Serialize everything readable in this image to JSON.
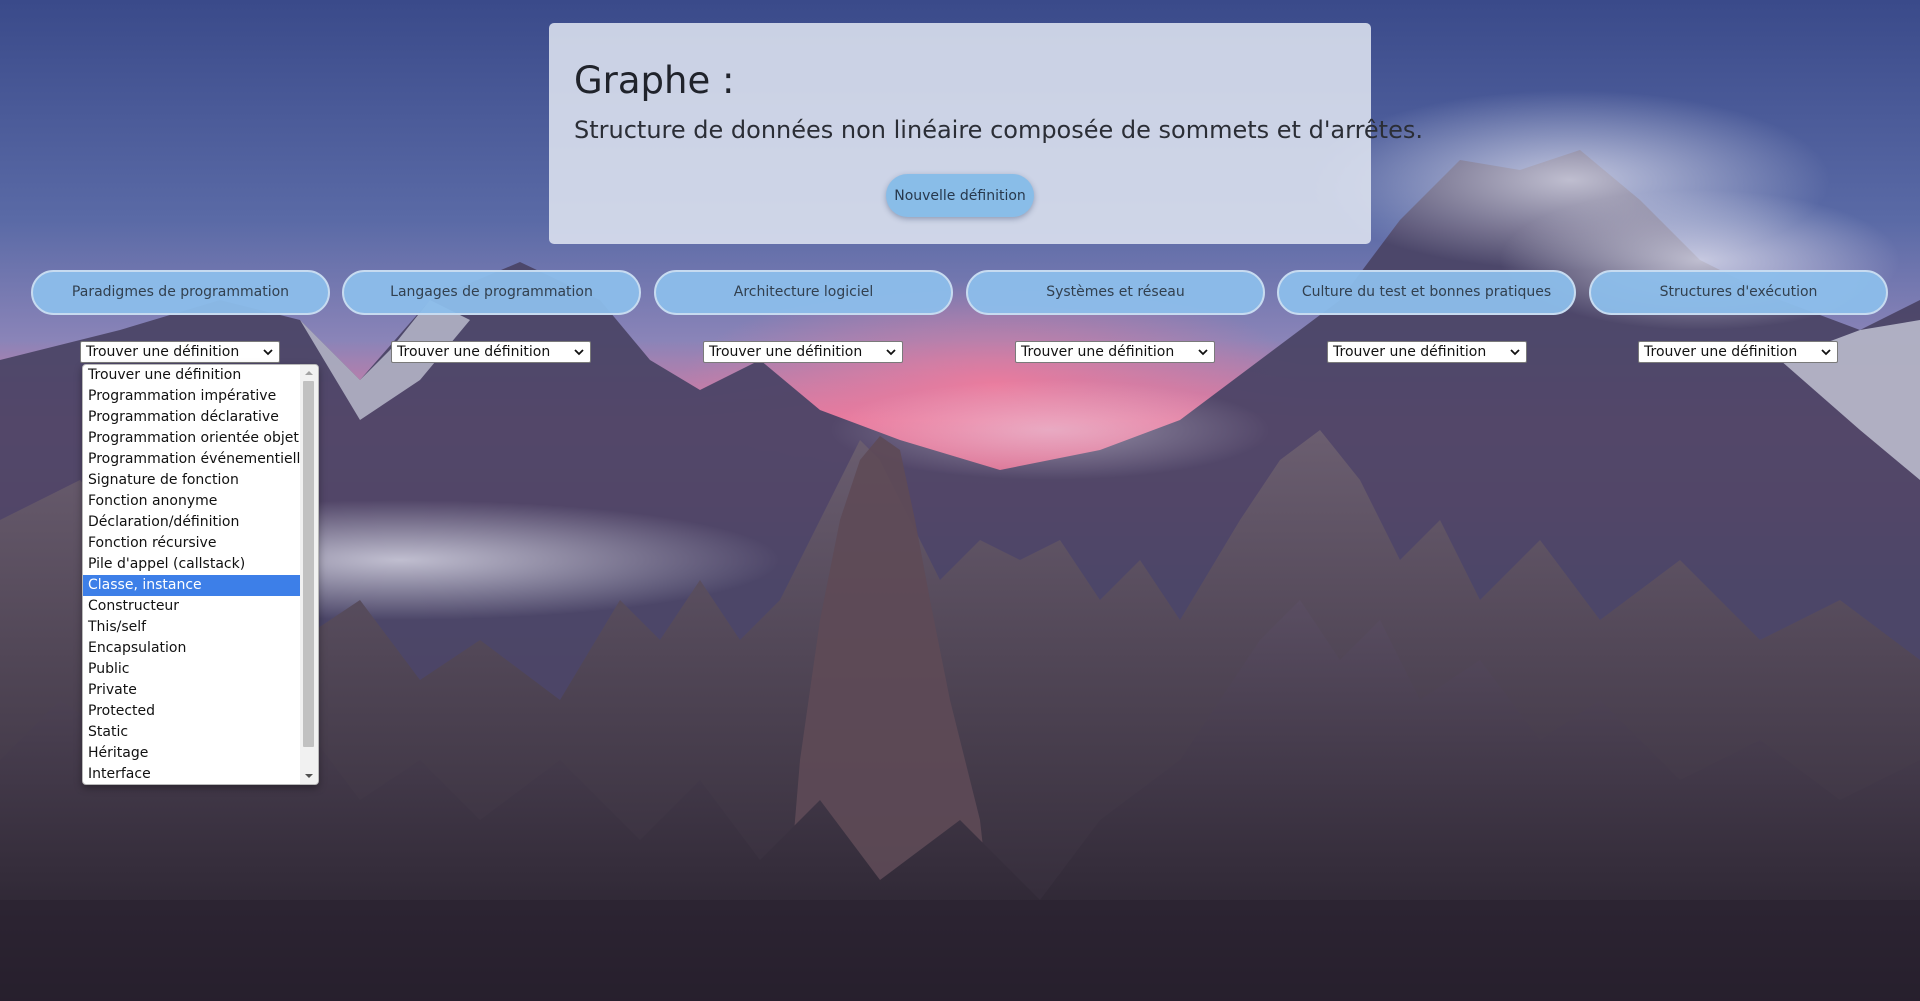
{
  "card": {
    "title": "Graphe :",
    "description": "Structure de données non linéaire composée de sommets et d'arrêtes.",
    "new_definition_button": "Nouvelle définition"
  },
  "tabs": [
    {
      "label": "Paradigmes de programmation"
    },
    {
      "label": "Langages de programmation"
    },
    {
      "label": "Architecture logiciel"
    },
    {
      "label": "Systèmes et réseau"
    },
    {
      "label": "Culture du test et bonnes pratiques"
    },
    {
      "label": "Structures d'exécution"
    }
  ],
  "selects": [
    {
      "value": "Trouver une définition"
    },
    {
      "value": "Trouver une définition"
    },
    {
      "value": "Trouver une définition"
    },
    {
      "value": "Trouver une définition"
    },
    {
      "value": "Trouver une définition"
    },
    {
      "value": "Trouver une définition"
    }
  ],
  "dropdown": {
    "highlighted_index": 10,
    "options": [
      "Trouver une définition",
      "Programmation impérative",
      "Programmation déclarative",
      "Programmation orientée objet",
      "Programmation événementielle",
      "Signature de fonction",
      "Fonction anonyme",
      "Déclaration/définition",
      "Fonction récursive",
      "Pile d'appel (callstack)",
      "Classe, instance",
      "Constructeur",
      "This/self",
      "Encapsulation",
      "Public",
      "Private",
      "Protected",
      "Static",
      "Héritage",
      "Interface"
    ]
  },
  "colors": {
    "button_blue": "#89bde8",
    "tab_blue": "#8cbeeb",
    "highlight": "#3d7fe8"
  }
}
